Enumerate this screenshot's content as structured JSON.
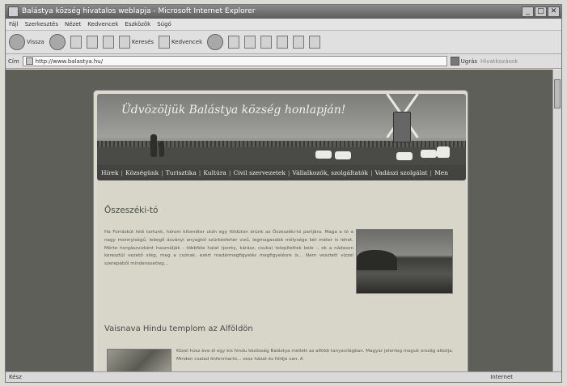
{
  "window": {
    "title": "Balástya község hivatalos weblapja - Microsoft Internet Explorer"
  },
  "menu": [
    "Fájl",
    "Szerkesztés",
    "Nézet",
    "Kedvencek",
    "Eszközök",
    "Súgó"
  ],
  "toolbar": {
    "back_label": "Vissza",
    "search_label": "Keresés",
    "favorites_label": "Kedvencek"
  },
  "address": {
    "label": "Cím",
    "url": "http://www.balastya.hu/",
    "go_label": "Ugrás",
    "links_label": "Hivatkozások"
  },
  "banner": {
    "title": "Üdvözöljük Balástya község honlapján!"
  },
  "nav": [
    "Hírek",
    "Községünk",
    "Turisztika",
    "Kultúra",
    "Civil szervezetek",
    "Vállalkozók, szolgáltatók",
    "Vadászi szolgálat",
    "Men"
  ],
  "article1": {
    "title": "Őszeszéki-tó",
    "text": "Ha Forráskút felé tartunk, három kilométer után egy földúton érünk az Őszeszéki-tó partjára. Maga a tó a nagy mennyiségű, lebegő ásványi anyagtól szürkésfehér vizű, legmagasabb mélysége két méter is lehet. Mérte horgászvizként használják - többféle halat (ponty, kárász, csuka) telepítettek bele -, ok a nádason keresztül vezető stég, meg a csónak, ezért madármegfigyelés megfigyelésre is... Nem vesztett vízzel szerepéből mindenesetleg..."
  },
  "article2": {
    "title": "Vaisnava Hindu templom az Alföldön",
    "text": "Közel húsz éve él egy kis hindu közösség Balástya mellett az alföldi tanyavilágban. Magyar jelenleg maguk ország alkotja. Minden csalad önfenntartó... vesz házat és földje van. A"
  },
  "status": {
    "left": "Kész",
    "zone": "Internet"
  }
}
